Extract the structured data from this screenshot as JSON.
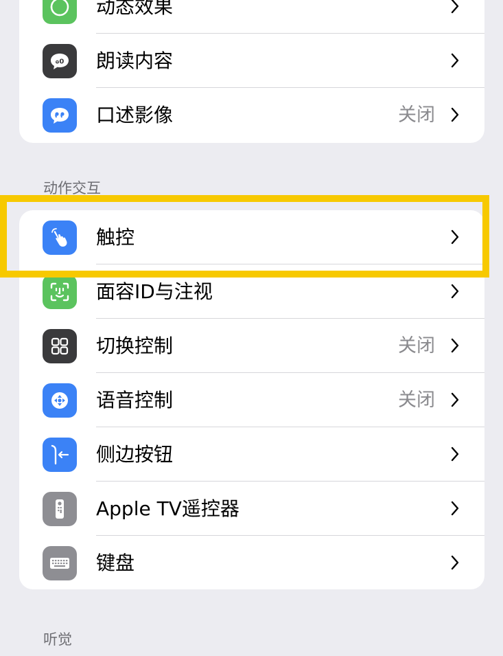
{
  "colors": {
    "highlight": "#F7C900",
    "background": "#ECECF1",
    "secondary_text": "#8A8A8E"
  },
  "vision_group": {
    "items": [
      {
        "label": "动态效果",
        "icon": "motion-icon",
        "icon_color": "#5BC35E"
      },
      {
        "label": "朗读内容",
        "icon": "spoken-content-icon",
        "icon_color": "#3A3A3C"
      },
      {
        "label": "口述影像",
        "icon": "audio-descriptions-icon",
        "icon_color": "#3B82F6",
        "value": "关闭"
      }
    ]
  },
  "interaction_group": {
    "header": "动作交互",
    "items": [
      {
        "label": "触控",
        "icon": "touch-icon",
        "icon_color": "#3B82F6"
      },
      {
        "label": "面容ID与注视",
        "icon": "face-id-icon",
        "icon_color": "#5BC35E"
      },
      {
        "label": "切换控制",
        "icon": "switch-control-icon",
        "icon_color": "#3A3A3C",
        "value": "关闭"
      },
      {
        "label": "语音控制",
        "icon": "voice-control-icon",
        "icon_color": "#3B82F6",
        "value": "关闭"
      },
      {
        "label": "侧边按钮",
        "icon": "side-button-icon",
        "icon_color": "#3B82F6"
      },
      {
        "label": "Apple TV遥控器",
        "icon": "apple-tv-remote-icon",
        "icon_color": "#8E8E93"
      },
      {
        "label": "键盘",
        "icon": "keyboard-icon",
        "icon_color": "#8E8E93"
      }
    ]
  },
  "hearing_group": {
    "header": "听觉"
  }
}
